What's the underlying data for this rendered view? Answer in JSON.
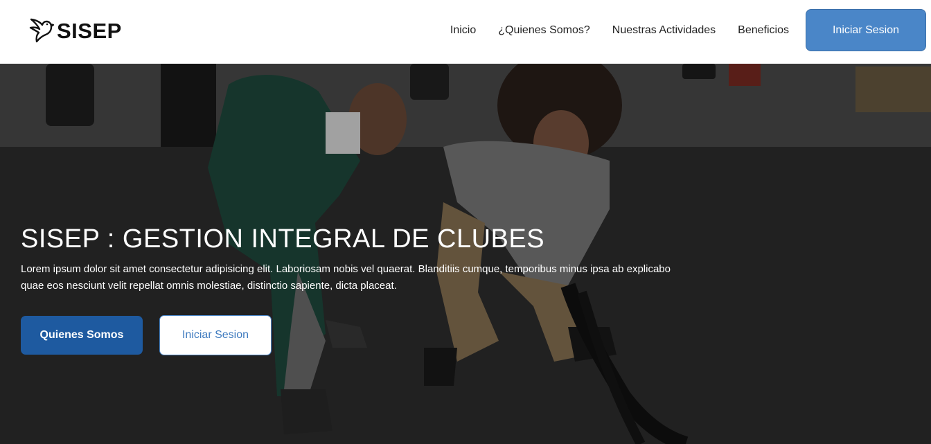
{
  "header": {
    "brand": "SISEP",
    "nav": [
      {
        "label": "Inicio"
      },
      {
        "label": "¿Quienes Somos?"
      },
      {
        "label": "Nuestras Actividades"
      },
      {
        "label": "Beneficios"
      }
    ],
    "login_label": "Iniciar Sesion"
  },
  "hero": {
    "title": "SISEP : GESTION INTEGRAL DE CLUBES",
    "text": "Lorem ipsum dolor sit amet consectetur adipisicing elit. Laboriosam nobis vel quaerat. Blanditiis cumque, temporibus minus ipsa ab explicabo quae eos nesciunt velit repellat omnis molestiae, distinctio sapiente, dicta placeat.",
    "primary_button": "Quienes Somos",
    "secondary_button": "Iniciar Sesion"
  },
  "colors": {
    "accent": "#4a86c8",
    "primary_button": "#1e5aa0"
  }
}
